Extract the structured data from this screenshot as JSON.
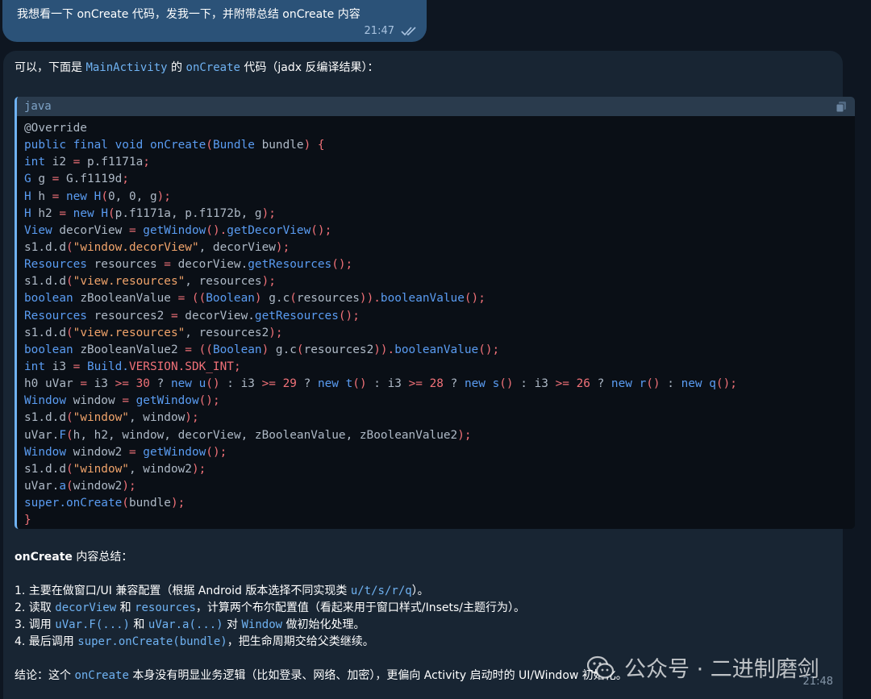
{
  "user_message": {
    "text": "我想看一下 onCreate 代码，发我一下，并附带总结 onCreate 内容",
    "time": "21:47",
    "status_icon": "double-check-icon"
  },
  "bot_message": {
    "intro": {
      "prefix": "可以，下面是 ",
      "class_name": "MainActivity",
      "middle": " 的 ",
      "method_name": "onCreate",
      "suffix": " 代码（jadx 反编译结果）："
    },
    "code": {
      "language": "java",
      "copy_icon": "copy-icon",
      "lines": [
        [
          [
            "@Override",
            "a"
          ]
        ],
        [
          [
            "public final void ",
            "k"
          ],
          [
            "onCreate",
            "k"
          ],
          [
            "(",
            "n"
          ],
          [
            "Bundle ",
            "k"
          ],
          [
            "bundle",
            "a"
          ],
          [
            ") {",
            "n"
          ]
        ],
        [
          [
            "int ",
            "k"
          ],
          [
            "i2 ",
            "a"
          ],
          [
            "= ",
            "n"
          ],
          [
            "p.f1171a",
            "a"
          ],
          [
            ";",
            "n"
          ]
        ],
        [
          [
            "G ",
            "k"
          ],
          [
            "g ",
            "a"
          ],
          [
            "= ",
            "n"
          ],
          [
            "G.f1119d",
            "a"
          ],
          [
            ";",
            "n"
          ]
        ],
        [
          [
            "H ",
            "k"
          ],
          [
            "h ",
            "a"
          ],
          [
            "= ",
            "n"
          ],
          [
            "new ",
            "k"
          ],
          [
            "H",
            "k"
          ],
          [
            "(",
            "n"
          ],
          [
            "0, 0, g",
            "a"
          ],
          [
            ");",
            "n"
          ]
        ],
        [
          [
            "H ",
            "k"
          ],
          [
            "h2 ",
            "a"
          ],
          [
            "= ",
            "n"
          ],
          [
            "new ",
            "k"
          ],
          [
            "H",
            "k"
          ],
          [
            "(",
            "n"
          ],
          [
            "p.f1171a, p.f1172b, g",
            "a"
          ],
          [
            ");",
            "n"
          ]
        ],
        [
          [
            "View ",
            "k"
          ],
          [
            "decorView ",
            "a"
          ],
          [
            "= ",
            "n"
          ],
          [
            "getWindow",
            "k"
          ],
          [
            "().",
            "n"
          ],
          [
            "getDecorView",
            "k"
          ],
          [
            "();",
            "n"
          ]
        ],
        [
          [
            "s1.d.d",
            "a"
          ],
          [
            "(",
            "n"
          ],
          [
            "\"window.decorView\"",
            "s"
          ],
          [
            ", decorView",
            "a"
          ],
          [
            ");",
            "n"
          ]
        ],
        [
          [
            "Resources ",
            "k"
          ],
          [
            "resources ",
            "a"
          ],
          [
            "= ",
            "n"
          ],
          [
            "decorView.",
            "a"
          ],
          [
            "getResources",
            "k"
          ],
          [
            "();",
            "n"
          ]
        ],
        [
          [
            "s1.d.d",
            "a"
          ],
          [
            "(",
            "n"
          ],
          [
            "\"view.resources\"",
            "s"
          ],
          [
            ", resources",
            "a"
          ],
          [
            ");",
            "n"
          ]
        ],
        [
          [
            "boolean ",
            "k"
          ],
          [
            "zBooleanValue ",
            "a"
          ],
          [
            "= ((",
            "n"
          ],
          [
            "Boolean",
            "k"
          ],
          [
            ") ",
            "n"
          ],
          [
            "g.c",
            "a"
          ],
          [
            "(",
            "n"
          ],
          [
            "resources",
            "a"
          ],
          [
            ")).",
            "n"
          ],
          [
            "booleanValue",
            "k"
          ],
          [
            "();",
            "n"
          ]
        ],
        [
          [
            "Resources ",
            "k"
          ],
          [
            "resources2 ",
            "a"
          ],
          [
            "= ",
            "n"
          ],
          [
            "decorView.",
            "a"
          ],
          [
            "getResources",
            "k"
          ],
          [
            "();",
            "n"
          ]
        ],
        [
          [
            "s1.d.d",
            "a"
          ],
          [
            "(",
            "n"
          ],
          [
            "\"view.resources\"",
            "s"
          ],
          [
            ", resources2",
            "a"
          ],
          [
            ");",
            "n"
          ]
        ],
        [
          [
            "boolean ",
            "k"
          ],
          [
            "zBooleanValue2 ",
            "a"
          ],
          [
            "= ((",
            "n"
          ],
          [
            "Boolean",
            "k"
          ],
          [
            ") ",
            "n"
          ],
          [
            "g.c",
            "a"
          ],
          [
            "(",
            "n"
          ],
          [
            "resources2",
            "a"
          ],
          [
            ")).",
            "n"
          ],
          [
            "booleanValue",
            "k"
          ],
          [
            "();",
            "n"
          ]
        ],
        [
          [
            "int ",
            "k"
          ],
          [
            "i3 ",
            "a"
          ],
          [
            "= ",
            "n"
          ],
          [
            "Build.",
            "k"
          ],
          [
            "VERSION.SDK_INT",
            "n"
          ],
          [
            ";",
            "n"
          ]
        ],
        [
          [
            "h0 uVar ",
            "a"
          ],
          [
            "= ",
            "n"
          ],
          [
            "i3 ",
            "a"
          ],
          [
            ">= ",
            "n"
          ],
          [
            "30 ",
            "n"
          ],
          [
            "? ",
            "a"
          ],
          [
            "new ",
            "k"
          ],
          [
            "u",
            "k"
          ],
          [
            "() ",
            "n"
          ],
          [
            ": i3 ",
            "a"
          ],
          [
            ">= ",
            "n"
          ],
          [
            "29 ",
            "n"
          ],
          [
            "? ",
            "a"
          ],
          [
            "new ",
            "k"
          ],
          [
            "t",
            "k"
          ],
          [
            "() ",
            "n"
          ],
          [
            ": i3 ",
            "a"
          ],
          [
            ">= ",
            "n"
          ],
          [
            "28 ",
            "n"
          ],
          [
            "? ",
            "a"
          ],
          [
            "new ",
            "k"
          ],
          [
            "s",
            "k"
          ],
          [
            "() ",
            "n"
          ],
          [
            ": i3 ",
            "a"
          ],
          [
            ">= ",
            "n"
          ],
          [
            "26 ",
            "n"
          ],
          [
            "? ",
            "a"
          ],
          [
            "new ",
            "k"
          ],
          [
            "r",
            "k"
          ],
          [
            "() ",
            "n"
          ],
          [
            ": ",
            "a"
          ],
          [
            "new ",
            "k"
          ],
          [
            "q",
            "k"
          ],
          [
            "();",
            "n"
          ]
        ],
        [
          [
            "Window ",
            "k"
          ],
          [
            "window ",
            "a"
          ],
          [
            "= ",
            "n"
          ],
          [
            "getWindow",
            "k"
          ],
          [
            "();",
            "n"
          ]
        ],
        [
          [
            "s1.d.d",
            "a"
          ],
          [
            "(",
            "n"
          ],
          [
            "\"window\"",
            "s"
          ],
          [
            ", window",
            "a"
          ],
          [
            ");",
            "n"
          ]
        ],
        [
          [
            "uVar.",
            "a"
          ],
          [
            "F",
            "k"
          ],
          [
            "(",
            "n"
          ],
          [
            "h, h2, window, decorView, zBooleanValue, zBooleanValue2",
            "a"
          ],
          [
            ");",
            "n"
          ]
        ],
        [
          [
            "Window ",
            "k"
          ],
          [
            "window2 ",
            "a"
          ],
          [
            "= ",
            "n"
          ],
          [
            "getWindow",
            "k"
          ],
          [
            "();",
            "n"
          ]
        ],
        [
          [
            "s1.d.d",
            "a"
          ],
          [
            "(",
            "n"
          ],
          [
            "\"window\"",
            "s"
          ],
          [
            ", window2",
            "a"
          ],
          [
            ");",
            "n"
          ]
        ],
        [
          [
            "uVar.",
            "a"
          ],
          [
            "a",
            "k"
          ],
          [
            "(",
            "n"
          ],
          [
            "window2",
            "a"
          ],
          [
            ");",
            "n"
          ]
        ],
        [
          [
            "super.",
            "k"
          ],
          [
            "onCreate",
            "k"
          ],
          [
            "(",
            "n"
          ],
          [
            "bundle",
            "a"
          ],
          [
            ");",
            "n"
          ]
        ],
        [
          [
            "}",
            "n"
          ]
        ]
      ]
    },
    "summary": {
      "heading_bold": "onCreate",
      "heading_rest": " 内容总结：",
      "items": [
        [
          [
            "1. 主要在做窗口/UI 兼容配置（根据 Android 版本选择不同实现类 ",
            "t"
          ],
          [
            "u/t/s/r/q",
            "c"
          ],
          [
            "）。",
            "t"
          ]
        ],
        [
          [
            "2. 读取 ",
            "t"
          ],
          [
            "decorView",
            "c"
          ],
          [
            " 和 ",
            "t"
          ],
          [
            "resources",
            "c"
          ],
          [
            "，计算两个布尔配置值（看起来用于窗口样式/Insets/主题行为）。",
            "t"
          ]
        ],
        [
          [
            "3. 调用 ",
            "t"
          ],
          [
            "uVar.F(...)",
            "c"
          ],
          [
            " 和 ",
            "t"
          ],
          [
            "uVar.a(...)",
            "c"
          ],
          [
            " 对 ",
            "t"
          ],
          [
            "Window",
            "c"
          ],
          [
            " 做初始化处理。",
            "t"
          ]
        ],
        [
          [
            "4. 最后调用 ",
            "t"
          ],
          [
            "super.onCreate(bundle)",
            "c"
          ],
          [
            "，把生命周期交给父类继续。",
            "t"
          ]
        ]
      ],
      "conclusion": [
        [
          "结论：这个 ",
          "t"
        ],
        [
          "onCreate",
          "c"
        ],
        [
          " 本身没有明显业务逻辑（比如登录、网络、加密），更偏向 Activity 启动时的 UI/Window 初始化。",
          "t"
        ]
      ]
    },
    "time": "21:48"
  },
  "watermark": {
    "icon": "wechat-icon",
    "text": "公众号 · 二进制磨剑"
  },
  "colors": {
    "background": "#0e1621",
    "user_bubble": "#2b5278",
    "bot_bubble": "#182533",
    "code_background": "#0a0f16",
    "inline_code": "#6fb2f2",
    "keyword": "#5a9cf2",
    "string": "#f0a36a",
    "punct": "#f07178"
  }
}
